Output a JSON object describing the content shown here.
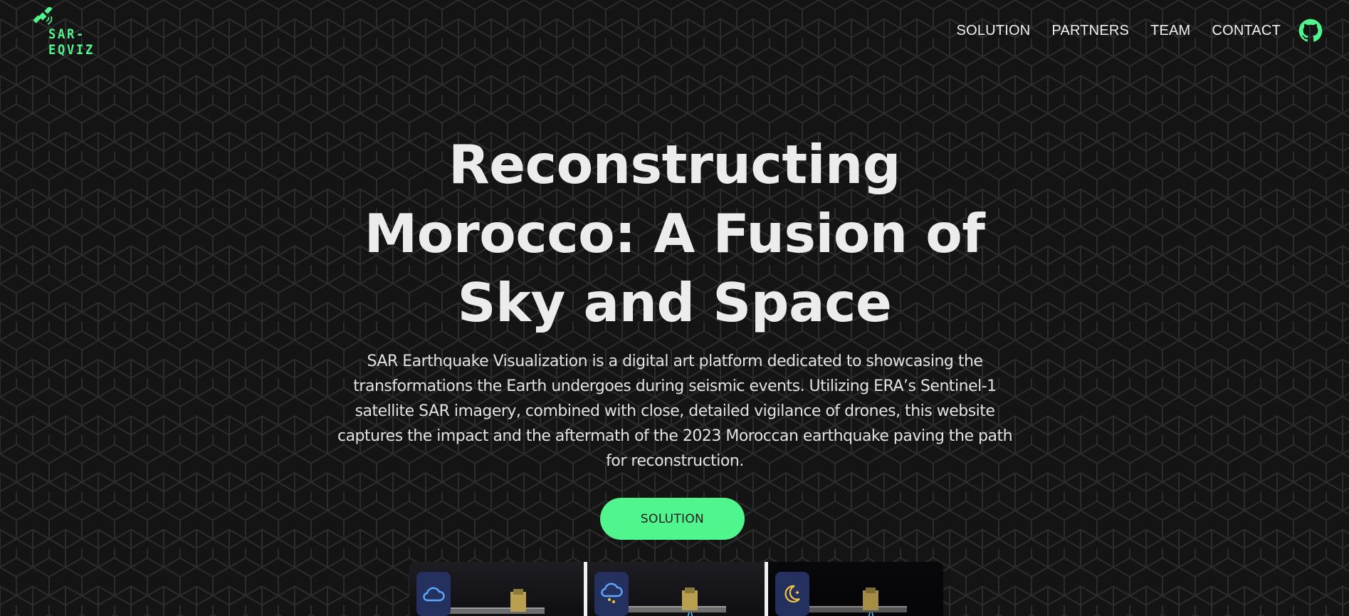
{
  "brand": {
    "name": "SAR-EQVIZ",
    "logo_icon": "satellite-icon",
    "accent_color": "#51f58d"
  },
  "nav": {
    "items": [
      {
        "label": "SOLUTION"
      },
      {
        "label": "PARTNERS"
      },
      {
        "label": "TEAM"
      },
      {
        "label": "CONTACT"
      }
    ],
    "github_icon": "github-icon"
  },
  "hero": {
    "title_lines": [
      "Reconstructing",
      "Morocco: A Fusion of",
      "Sky and Space"
    ],
    "description": "SAR Earthquake Visualization is a digital art platform dedicated to showcasing the transformations the Earth undergoes during seismic events. Utilizing ERA’s Sentinel-1 satellite SAR imagery, combined with close, detailed vigilance of drones, this website captures the impact and the aftermath of the 2023 Moroccan earthquake paving the path for reconstruction.",
    "cta_label": "SOLUTION"
  },
  "cards": [
    {
      "icon": "cloud-icon",
      "image": "satellite-image"
    },
    {
      "icon": "rain-cloud-icon",
      "image": "satellite-image"
    },
    {
      "icon": "moon-star-icon",
      "image": "satellite-image"
    }
  ],
  "colors": {
    "background": "#141414",
    "pattern_line": "#2a2a2a",
    "card_icon_bg": "#24305e"
  }
}
